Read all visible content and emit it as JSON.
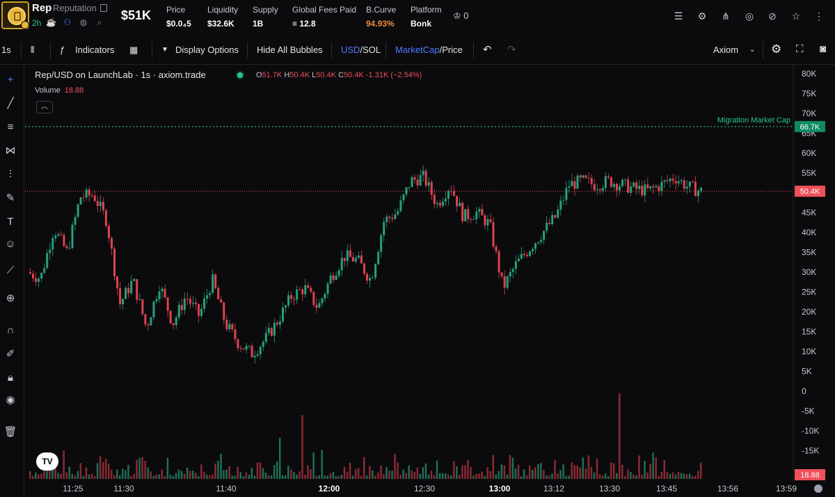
{
  "header": {
    "ticker": "Rep",
    "name": "Reputation",
    "age": "2h",
    "market_cap": "$51K",
    "stats": [
      {
        "label": "Price",
        "value": "$0.0₄5"
      },
      {
        "label": "Liquidity",
        "value": "$32.6K"
      },
      {
        "label": "Supply",
        "value": "1B"
      },
      {
        "label": "Global Fees Paid",
        "value": "≡ 12.8"
      },
      {
        "label": "B.Curve",
        "value": "94.93%"
      },
      {
        "label": "Platform",
        "value": "Bonk"
      }
    ],
    "crown_count": "0",
    "colors": {
      "accent_orange": "#f08a3a",
      "green": "#25c98a",
      "red": "#f0505a",
      "blue": "#4f7cff"
    }
  },
  "toolbar": {
    "interval": "1s",
    "indicators": "Indicators",
    "display_options": "Display Options",
    "hide_bubbles": "Hide All Bubbles",
    "usd": "USD",
    "sol": "/SOL",
    "mcap": "MarketCap",
    "price": "/Price",
    "source": "Axiom"
  },
  "chart": {
    "title": "Rep/USD on LaunchLab · 1s · axiom.trade",
    "ohlc": {
      "o_label": "O",
      "o": "51.7K",
      "h_label": "H",
      "h": "50.4K",
      "l_label": "L",
      "l": "50.4K",
      "c_label": "C",
      "c": "50.4K",
      "change": "-1.31K (−2.54%)"
    },
    "volume_label": "Volume",
    "volume_value": "18.88",
    "migration_label": "Migration Market Cap",
    "migration_value": "66.7K",
    "last_price_label": "50.4K",
    "volume_axis_label": "18.88"
  },
  "chart_data": {
    "type": "candlestick",
    "title": "Rep/USD on LaunchLab · 1s · axiom.trade",
    "y_ticks": [
      "80K",
      "75K",
      "70K",
      "65K",
      "60K",
      "55K",
      "50K",
      "45K",
      "40K",
      "35K",
      "30K",
      "25K",
      "20K",
      "15K",
      "10K",
      "5K",
      "0",
      "-5K",
      "-10K",
      "-15K"
    ],
    "x_ticks": [
      "11:25",
      "11:30",
      "11:40",
      "12:00",
      "12:30",
      "13:00",
      "13:12",
      "13:30",
      "13:45",
      "13:56",
      "13:59"
    ],
    "ylim": [
      -20000,
      82000
    ],
    "reference_lines": [
      {
        "name": "Migration Market Cap",
        "value": 66700
      },
      {
        "name": "last",
        "value": 50400
      }
    ],
    "x": [
      "11:22",
      "11:25",
      "11:28",
      "11:30",
      "11:31",
      "11:34",
      "11:37",
      "11:40",
      "11:43",
      "11:46",
      "11:49",
      "11:52",
      "11:55",
      "11:58",
      "12:00",
      "12:03",
      "12:06",
      "12:09",
      "12:12",
      "12:15",
      "12:18",
      "12:21",
      "12:24",
      "12:27",
      "12:30",
      "12:33",
      "12:36",
      "12:39",
      "12:42",
      "12:45",
      "12:48",
      "12:51",
      "12:54",
      "12:57",
      "13:00",
      "13:03",
      "13:06",
      "13:09",
      "13:12",
      "13:15",
      "13:18",
      "13:21",
      "13:24",
      "13:27",
      "13:30",
      "13:33",
      "13:36",
      "13:39",
      "13:42",
      "13:45",
      "13:48",
      "13:50"
    ],
    "values": [
      30000,
      28500,
      41000,
      35000,
      49000,
      49500,
      43000,
      22000,
      28000,
      16000,
      27000,
      17000,
      24000,
      19000,
      28000,
      17000,
      12000,
      9500,
      13000,
      18000,
      24000,
      26000,
      21000,
      29000,
      34000,
      33000,
      28000,
      43000,
      45000,
      53000,
      54000,
      47000,
      52000,
      44000,
      45000,
      42000,
      26000,
      32000,
      36000,
      40000,
      44000,
      52000,
      53000,
      52000,
      53000,
      52000,
      51000,
      50500,
      52000,
      54000,
      51500,
      50400
    ]
  }
}
